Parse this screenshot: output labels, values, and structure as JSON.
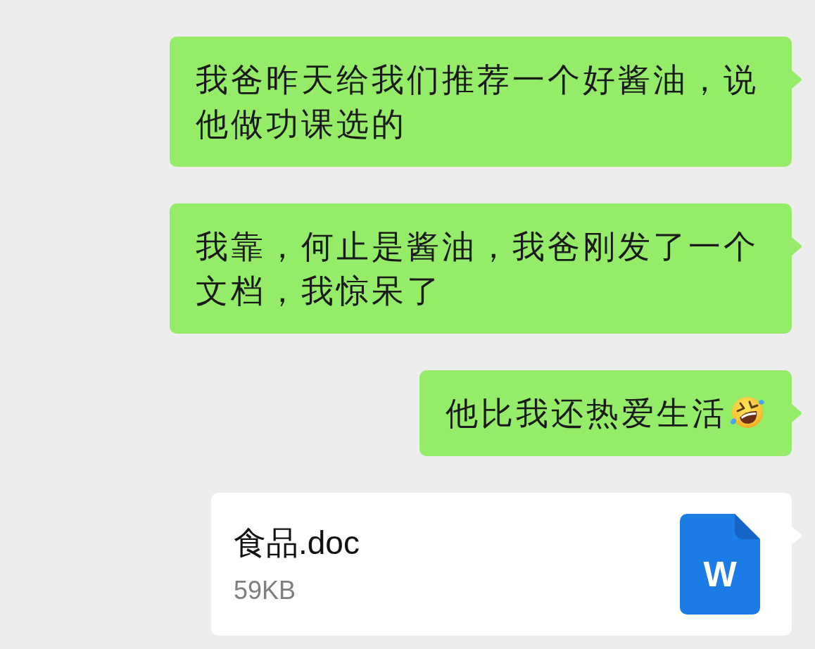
{
  "messages": [
    {
      "kind": "text",
      "text": "我爸昨天给我们推荐一个好酱油，说他做功课选的",
      "emoji": false
    },
    {
      "kind": "text",
      "text": "我靠，何止是酱油，我爸刚发了一个文档，我惊呆了",
      "emoji": false
    },
    {
      "kind": "text",
      "text": "他比我还热爱生活",
      "emoji": true
    },
    {
      "kind": "file",
      "file_name": "食品.doc",
      "file_size": "59KB",
      "icon_label": "W"
    }
  ]
}
